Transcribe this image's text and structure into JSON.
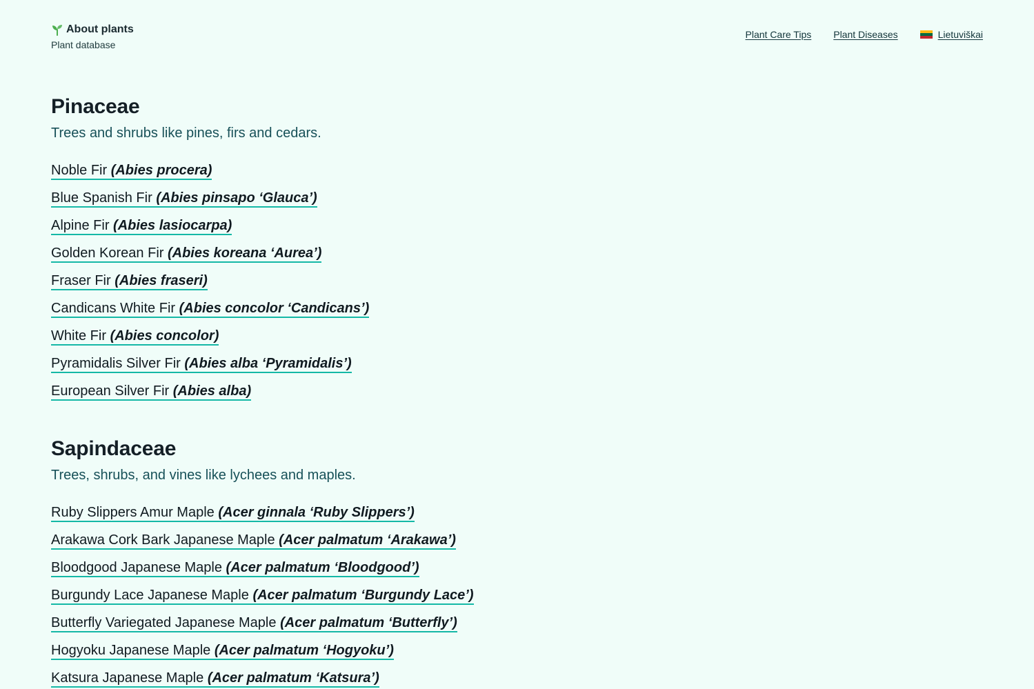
{
  "header": {
    "brand_title": "About plants",
    "brand_subtitle": "Plant database",
    "brand_icon": "sprout-icon",
    "nav": {
      "care_tips": "Plant Care Tips",
      "diseases": "Plant Diseases",
      "language": "Lietuviškai",
      "language_flag": "lithuania-flag-icon"
    }
  },
  "colors": {
    "background": "#f0fdf9",
    "accent_underline": "#14b8a6",
    "description_text": "#175058",
    "sprout": "#4caf50"
  },
  "families": [
    {
      "name": "Pinaceae",
      "description": "Trees and shrubs like pines, firs and cedars.",
      "plants": [
        {
          "common": "Noble Fir",
          "scientific": "(Abies procera)"
        },
        {
          "common": "Blue Spanish Fir",
          "scientific": "(Abies pinsapo ‘Glauca’)"
        },
        {
          "common": "Alpine Fir",
          "scientific": "(Abies lasiocarpa)"
        },
        {
          "common": "Golden Korean Fir",
          "scientific": "(Abies koreana ‘Aurea’)"
        },
        {
          "common": "Fraser Fir",
          "scientific": "(Abies fraseri)"
        },
        {
          "common": "Candicans White Fir",
          "scientific": "(Abies concolor ‘Candicans’)"
        },
        {
          "common": "White Fir",
          "scientific": "(Abies concolor)"
        },
        {
          "common": "Pyramidalis Silver Fir",
          "scientific": "(Abies alba ‘Pyramidalis’)"
        },
        {
          "common": "European Silver Fir",
          "scientific": "(Abies alba)"
        }
      ]
    },
    {
      "name": "Sapindaceae",
      "description": "Trees, shrubs, and vines like lychees and maples.",
      "plants": [
        {
          "common": "Ruby Slippers Amur Maple",
          "scientific": "(Acer ginnala ‘Ruby Slippers’)"
        },
        {
          "common": "Arakawa Cork Bark Japanese Maple",
          "scientific": "(Acer palmatum ‘Arakawa’)"
        },
        {
          "common": "Bloodgood Japanese Maple",
          "scientific": "(Acer palmatum ‘Bloodgood’)"
        },
        {
          "common": "Burgundy Lace Japanese Maple",
          "scientific": "(Acer palmatum ‘Burgundy Lace’)"
        },
        {
          "common": "Butterfly Variegated Japanese Maple",
          "scientific": "(Acer palmatum ‘Butterfly’)"
        },
        {
          "common": "Hogyoku Japanese Maple",
          "scientific": "(Acer palmatum ‘Hogyoku’)"
        },
        {
          "common": "Katsura Japanese Maple",
          "scientific": "(Acer palmatum ‘Katsura’)"
        }
      ]
    }
  ]
}
